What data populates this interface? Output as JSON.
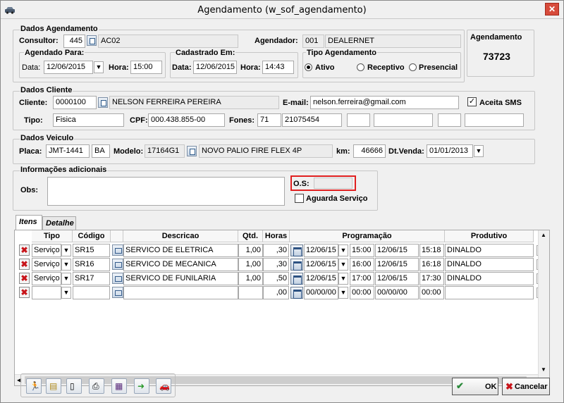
{
  "window": {
    "title": "Agendamento (w_sof_agendamento)"
  },
  "dados_agendamento": {
    "title": "Dados Agendamento",
    "consultor_label": "Consultor:",
    "consultor_code": "445",
    "consultor_name": "AC02",
    "agendador_label": "Agendador:",
    "agendador_code": "001",
    "agendador_name": "DEALERNET",
    "agendado_para": {
      "title": "Agendado Para:",
      "data_label": "Data:",
      "data": "12/06/2015",
      "hora_label": "Hora:",
      "hora": "15:00"
    },
    "cadastrado_em": {
      "title": "Cadastrado Em:",
      "data_label": "Data:",
      "data": "12/06/2015",
      "hora_label": "Hora:",
      "hora": "14:43"
    },
    "tipo_agendamento": {
      "title": "Tipo Agendamento",
      "options": [
        "Ativo",
        "Receptivo",
        "Presencial"
      ],
      "selected": "Ativo"
    },
    "agendamento_box": {
      "label": "Agendamento",
      "number": "73723"
    }
  },
  "dados_cliente": {
    "title": "Dados Cliente",
    "cliente_label": "Cliente:",
    "cliente_code": "0000100",
    "cliente_name": "NELSON FERREIRA PEREIRA",
    "email_label": "E-mail:",
    "email": "nelson.ferreira@gmail.com",
    "aceita_sms_label": "Aceita SMS",
    "tipo_label": "Tipo:",
    "tipo": "Fisica",
    "cpf_label": "CPF:",
    "cpf": "000.438.855-00",
    "fones_label": "Fones:",
    "fone_ddd": "71",
    "fone_num": "21075454"
  },
  "dados_veiculo": {
    "title": "Dados Veiculo",
    "placa_label": "Placa:",
    "placa": "JMT-1441",
    "uf": "BA",
    "modelo_label": "Modelo:",
    "modelo_code": "17164G1",
    "modelo_name": "NOVO PALIO FIRE FLEX 4P",
    "km_label": "km:",
    "km": "46666",
    "dtvenda_label": "Dt.Venda:",
    "dtvenda": "01/01/2013"
  },
  "informacoes": {
    "title": "Informações adicionais",
    "obs_label": "Obs:",
    "obs": "",
    "os_label": "O.S:",
    "os": "",
    "aguarda_label": "Aguarda Serviço"
  },
  "tabs": [
    "Itens",
    "Detalhe"
  ],
  "grid": {
    "headers": {
      "tipo": "Tipo",
      "codigo": "Código",
      "descricao": "Descricao",
      "qtd": "Qtd.",
      "horas": "Horas",
      "programacao": "Programação",
      "produtivo": "Produtivo"
    },
    "rows": [
      {
        "tipo": "Serviço",
        "codigo": "SR15",
        "descricao": "SERVICO DE ELETRICA",
        "qtd": "1,00",
        "horas": ",30",
        "d1": "12/06/15",
        "h1": "15:00",
        "d2": "12/06/15",
        "h2": "15:18",
        "produtivo": "DINALDO"
      },
      {
        "tipo": "Serviço",
        "codigo": "SR16",
        "descricao": "SERVICO DE MECANICA",
        "qtd": "1,00",
        "horas": ",30",
        "d1": "12/06/15",
        "h1": "16:00",
        "d2": "12/06/15",
        "h2": "16:18",
        "produtivo": "DINALDO"
      },
      {
        "tipo": "Serviço",
        "codigo": "SR17",
        "descricao": "SERVICO DE FUNILARIA",
        "qtd": "1,00",
        "horas": ",50",
        "d1": "12/06/15",
        "h1": "17:00",
        "d2": "12/06/15",
        "h2": "17:30",
        "produtivo": "DINALDO"
      },
      {
        "tipo": "",
        "codigo": "",
        "descricao": "",
        "qtd": "",
        "horas": ",00",
        "d1": "00/00/00",
        "h1": "00:00",
        "d2": "00/00/00",
        "h2": "00:00",
        "produtivo": ""
      }
    ]
  },
  "buttons": {
    "ok": "OK",
    "cancelar": "Cancelar"
  },
  "colors": {
    "os_highlight": "#e02020",
    "delete_icon": "#c8141a"
  }
}
